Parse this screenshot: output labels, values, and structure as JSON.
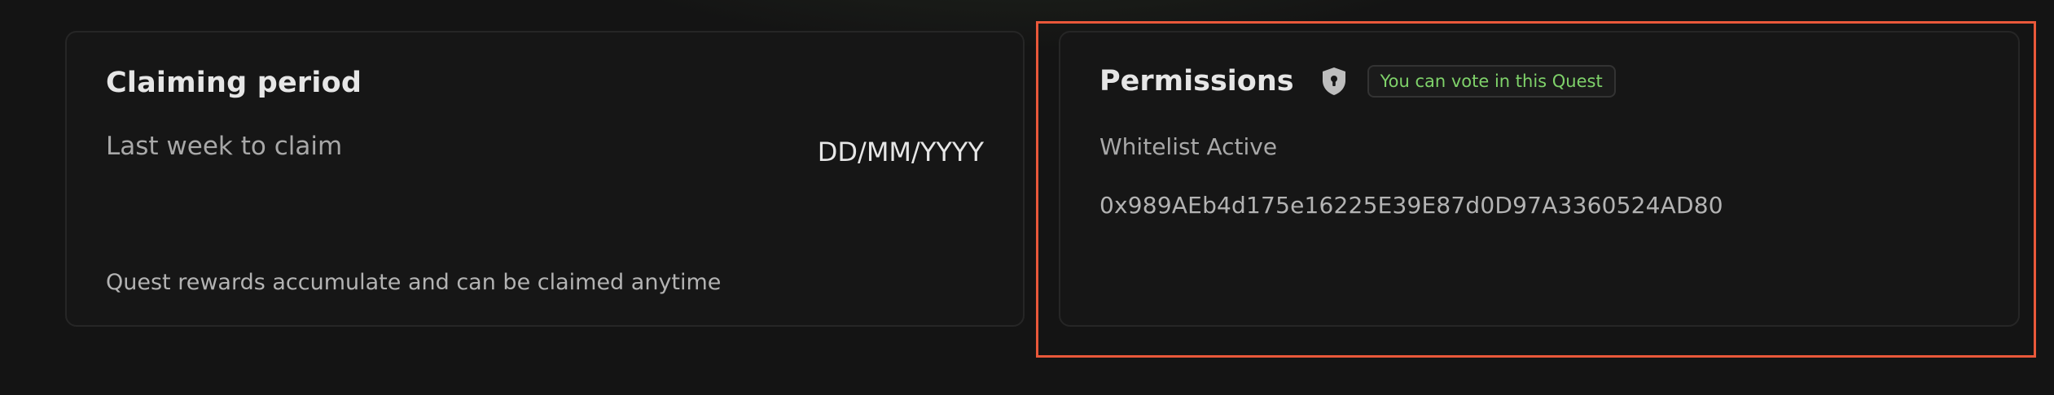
{
  "claiming": {
    "title": "Claiming period",
    "label": "Last week to claim",
    "date": "DD/MM/YYYY",
    "note": "Quest rewards accumulate and can be claimed anytime"
  },
  "permissions": {
    "title": "Permissions",
    "icon": "shield-lock-icon",
    "badge": "You can vote in this Quest",
    "badge_color": "#7fd26a",
    "whitelist_label": "Whitelist Active",
    "whitelist_address": "0x989AEb4d175e16225E39E87d0D97A3360524AD80"
  },
  "colors": {
    "highlight": "#e9583a"
  }
}
